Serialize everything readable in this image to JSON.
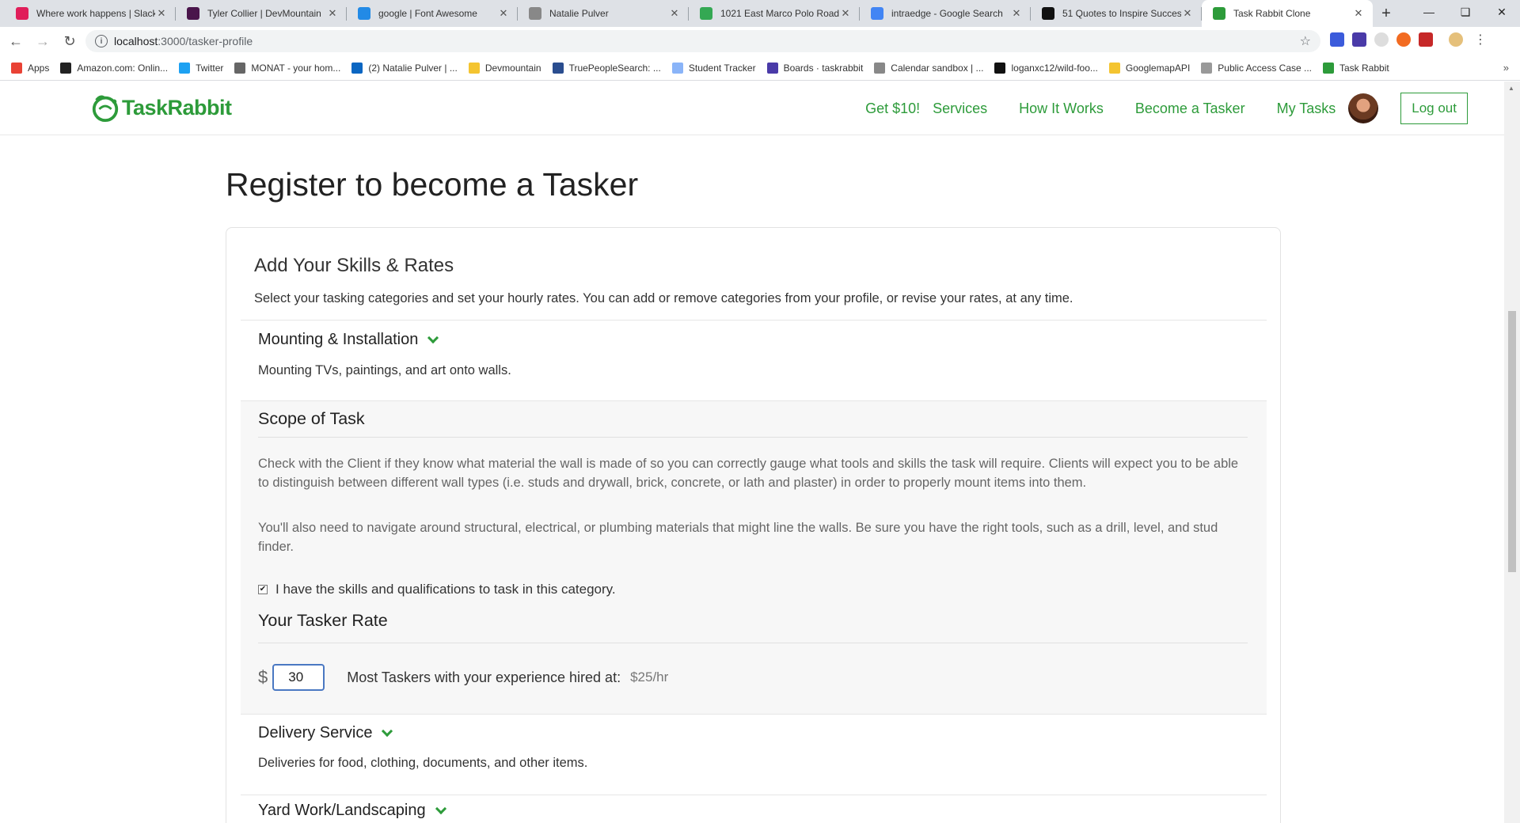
{
  "browser": {
    "tabs": [
      {
        "title": "Where work happens | Slack",
        "color": "#e01e5a",
        "icon": "slack-icon"
      },
      {
        "title": "Tyler Collier | DevMountain",
        "color": "#4a154b",
        "icon": "devmountain-icon"
      },
      {
        "title": "google | Font Awesome",
        "color": "#228ae6",
        "icon": "font-awesome-icon"
      },
      {
        "title": "Natalie Pulver",
        "color": "#888888",
        "icon": "page-icon"
      },
      {
        "title": "1021 East Marco Polo Road",
        "color": "#34a853",
        "icon": "google-maps-icon"
      },
      {
        "title": "intraedge - Google Search",
        "color": "#4285f4",
        "icon": "google-icon"
      },
      {
        "title": "51 Quotes to Inspire Success",
        "color": "#111111",
        "icon": "inc-icon"
      },
      {
        "title": "Task Rabbit Clone",
        "color": "#2d9b3a",
        "icon": "taskrabbit-icon",
        "active": true
      }
    ],
    "url_host": "localhost",
    "url_rest": ":3000/tasker-profile",
    "bookmarks": [
      {
        "label": "Apps",
        "color": "#e94235"
      },
      {
        "label": "Amazon.com: Onlin...",
        "color": "#222222"
      },
      {
        "label": "Twitter",
        "color": "#1da1f2"
      },
      {
        "label": "MONAT - your hom...",
        "color": "#666666"
      },
      {
        "label": "(2) Natalie Pulver | ...",
        "color": "#0a66c2"
      },
      {
        "label": "Devmountain",
        "color": "#f4c430"
      },
      {
        "label": "TruePeopleSearch: ...",
        "color": "#2a4d8f"
      },
      {
        "label": "Student Tracker",
        "color": "#8ab4f8"
      },
      {
        "label": "Boards · taskrabbit",
        "color": "#4a3aa8"
      },
      {
        "label": "Calendar sandbox | ...",
        "color": "#888888"
      },
      {
        "label": "loganxc12/wild-foo...",
        "color": "#111111"
      },
      {
        "label": "GooglemapAPI",
        "color": "#f4c430"
      },
      {
        "label": "Public Access Case ...",
        "color": "#999999"
      },
      {
        "label": "Task Rabbit",
        "color": "#2d9b3a"
      }
    ]
  },
  "header": {
    "brand": "TaskRabbit",
    "nav": [
      "Get $10!",
      "Services",
      "How It Works",
      "Become a Tasker",
      "My Tasks"
    ],
    "logout": "Log out"
  },
  "page_title": "Register to become a Tasker",
  "skills": {
    "heading": "Add Your Skills & Rates",
    "subtitle": "Select your tasking categories and set your hourly rates. You can add or remove categories from your profile, or revise your rates, at any time.",
    "categories": [
      {
        "title": "Mounting & Installation",
        "desc": "Mounting TVs, paintings, and art onto walls."
      },
      {
        "title": "Delivery Service",
        "desc": "Deliveries for food, clothing, documents, and other items."
      },
      {
        "title": "Yard Work/Landscaping",
        "desc": ""
      }
    ],
    "scope": {
      "heading": "Scope of Task",
      "para1": "Check with the Client if they know what material the wall is made of so you can correctly gauge what tools and skills the task will require. Clients will expect you to be able to distinguish between different wall types (i.e. studs and drywall, brick, concrete, or lath and plaster) in order to properly mount items into them.",
      "para2": "You'll also need to navigate around structural, electrical, or plumbing materials that might line the walls. Be sure you have the right tools, such as a drill, level, and stud finder.",
      "checkbox_label": "I have the skills and qualifications to task in this category.",
      "checked": true,
      "rate_heading": "Your Tasker Rate",
      "currency": "$",
      "rate_value": "30",
      "most_label": "Most Taskers with your experience hired at:",
      "most_rate": "$25/hr"
    }
  }
}
